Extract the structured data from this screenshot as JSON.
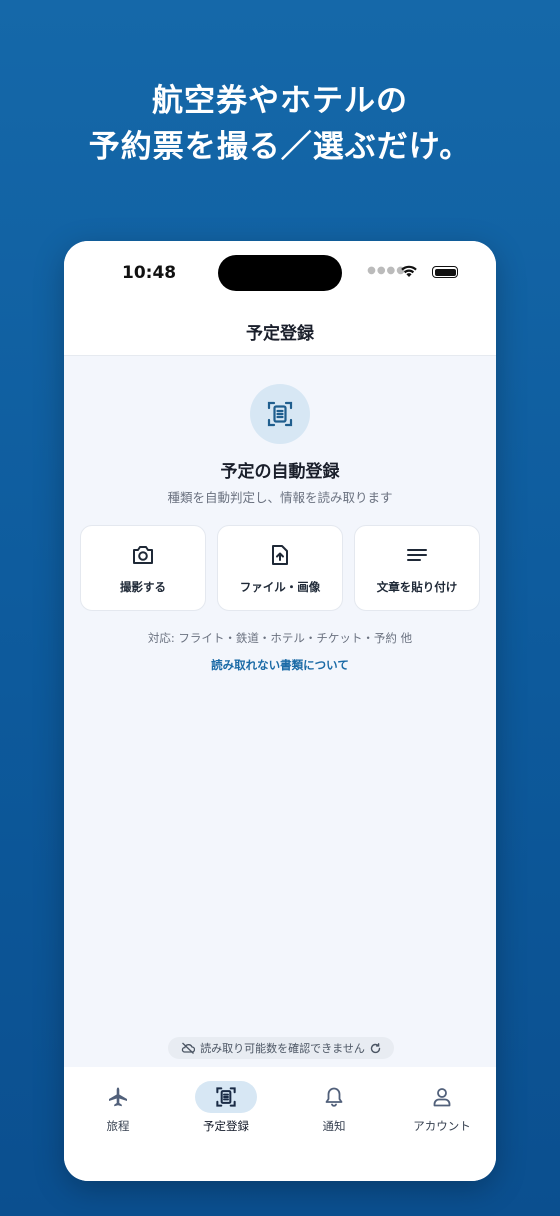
{
  "headline": {
    "line1": "航空券やホテルの",
    "line2": "予約票を撮る／選ぶだけ。"
  },
  "status_bar": {
    "time": "10:48"
  },
  "screen": {
    "title": "予定登録",
    "main_title": "予定の自動登録",
    "subtitle": "種類を自動判定し、情報を読み取ります",
    "options": [
      {
        "label": "撮影する",
        "icon": "camera-icon"
      },
      {
        "label": "ファイル・画像",
        "icon": "file-upload-icon"
      },
      {
        "label": "文章を貼り付け",
        "icon": "text-lines-icon"
      }
    ],
    "supported_text": "対応: フライト・鉄道・ホテル・チケット・予約 他",
    "unreadable_link": "読み取れない書類について",
    "quota_notice": "読み取り可能数を確認できません"
  },
  "tabbar": {
    "items": [
      {
        "label": "旅程",
        "icon": "airplane-icon"
      },
      {
        "label": "予定登録",
        "icon": "scan-document-icon",
        "active": true
      },
      {
        "label": "通知",
        "icon": "bell-icon"
      },
      {
        "label": "アカウント",
        "icon": "user-icon"
      }
    ]
  },
  "colors": {
    "background": "#1568a9",
    "accent": "#1a6aa6",
    "active_tab_bg": "#d7e7f4"
  }
}
